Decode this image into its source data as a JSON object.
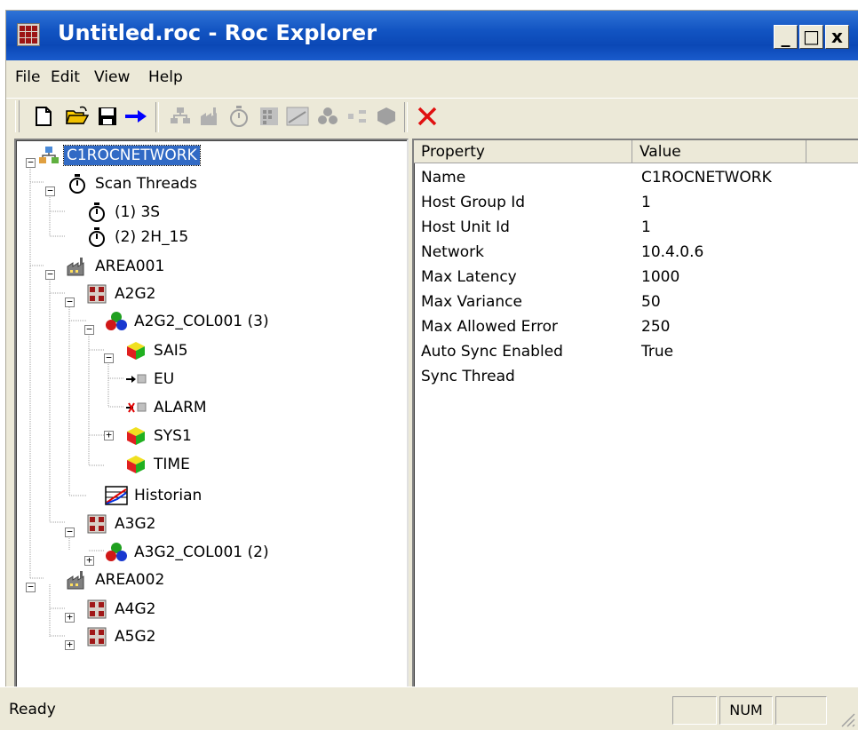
{
  "window": {
    "title": "Untitled.roc - Roc Explorer",
    "controls": {
      "minimize": "_",
      "maximize": "□",
      "close": "x"
    }
  },
  "menu": [
    "File",
    "Edit",
    "View",
    "Help"
  ],
  "toolbar": {
    "icons": [
      "new-file-icon",
      "open-folder-icon",
      "save-icon",
      "arrow-right-icon",
      "network-icon",
      "area-icon",
      "scan-thread-icon",
      "group-icon",
      "historian-icon",
      "collection-icon",
      "point-icon",
      "object-icon",
      "delete-icon"
    ]
  },
  "tree": {
    "nodes": [
      {
        "label": "C1ROCNETWORK",
        "icon": "network-icon",
        "selected": true
      },
      {
        "label": "Scan Threads",
        "icon": "stopwatch-icon"
      },
      {
        "label": "(1) 3S",
        "icon": "stopwatch-icon"
      },
      {
        "label": "(2) 2H_15",
        "icon": "stopwatch-icon"
      },
      {
        "label": "AREA001",
        "icon": "factory-icon"
      },
      {
        "label": "A2G2",
        "icon": "grid-icon"
      },
      {
        "label": "A2G2_COL001 (3)",
        "icon": "balls-icon"
      },
      {
        "label": "SAI5",
        "icon": "cube-icon"
      },
      {
        "label": "EU",
        "icon": "input-point-icon"
      },
      {
        "label": "ALARM",
        "icon": "alarm-point-icon"
      },
      {
        "label": "SYS1",
        "icon": "cube-icon"
      },
      {
        "label": "TIME",
        "icon": "cube-icon"
      },
      {
        "label": "Historian",
        "icon": "chart-icon"
      },
      {
        "label": "A3G2",
        "icon": "grid-icon"
      },
      {
        "label": "A3G2_COL001 (2)",
        "icon": "balls-icon"
      },
      {
        "label": "AREA002",
        "icon": "factory-icon"
      },
      {
        "label": "A4G2",
        "icon": "grid-icon"
      },
      {
        "label": "A5G2",
        "icon": "grid-icon"
      }
    ]
  },
  "properties": {
    "headers": [
      "Property",
      "Value"
    ],
    "rows": [
      [
        "Name",
        "C1ROCNETWORK"
      ],
      [
        "Host Group Id",
        "1"
      ],
      [
        "Host Unit Id",
        "1"
      ],
      [
        "Network",
        "10.4.0.6"
      ],
      [
        "Max Latency",
        "1000"
      ],
      [
        "Max Variance",
        "50"
      ],
      [
        "Max Allowed Error",
        "250"
      ],
      [
        "Auto Sync Enabled",
        "True"
      ],
      [
        "Sync Thread",
        ""
      ]
    ]
  },
  "statusbar": {
    "text": "Ready",
    "indicators": [
      "",
      "NUM",
      ""
    ]
  }
}
